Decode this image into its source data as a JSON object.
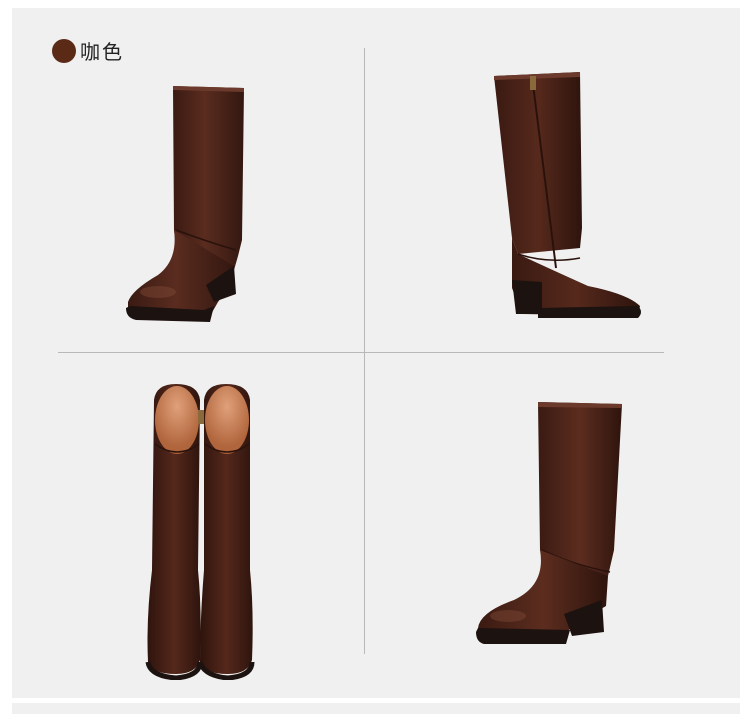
{
  "color_option": {
    "label": "咖色",
    "swatch_color": "#5a2a16"
  },
  "colors": {
    "leather": "#4a2219",
    "leather_dark": "#2e140d",
    "leather_highlight": "#6b3a2c",
    "sole": "#1c1210",
    "lining": "#c77a4d",
    "background": "#f0f0f0"
  },
  "views": [
    {
      "name": "side-view-outer"
    },
    {
      "name": "side-view-inner-zipper"
    },
    {
      "name": "front-pair-view"
    },
    {
      "name": "angled-side-view"
    }
  ]
}
